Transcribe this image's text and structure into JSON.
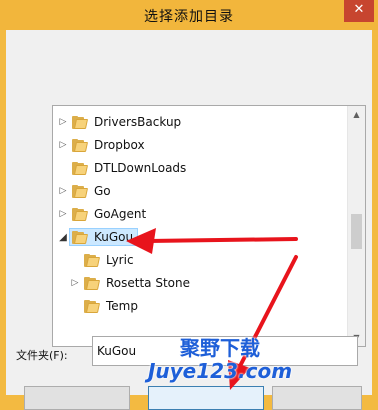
{
  "window": {
    "title": "选择添加目录",
    "close_glyph": "✕"
  },
  "tree": {
    "items": [
      {
        "label": "DriversBackup",
        "expander": "▷"
      },
      {
        "label": "Dropbox",
        "expander": "▷"
      },
      {
        "label": "DTLDownLoads",
        "expander": ""
      },
      {
        "label": "Go",
        "expander": "▷"
      },
      {
        "label": "GoAgent",
        "expander": "▷"
      },
      {
        "label": "KuGou",
        "expander": "◢",
        "selected": true
      },
      {
        "label": "Lyric",
        "expander": ""
      },
      {
        "label": "Rosetta Stone",
        "expander": "▷"
      },
      {
        "label": "Temp",
        "expander": ""
      }
    ]
  },
  "scrollbar": {
    "up": "▲",
    "down": "▼"
  },
  "folder_field": {
    "label": "文件夹(F):",
    "value": "KuGou"
  },
  "watermark": {
    "line1": "聚野下载",
    "line2": "Juye123.com"
  },
  "colors": {
    "title_bar": "#f2b63c",
    "annotation_arrow": "#e8141c",
    "selection": "#cce8ff",
    "watermark": "#1e5fd8"
  }
}
